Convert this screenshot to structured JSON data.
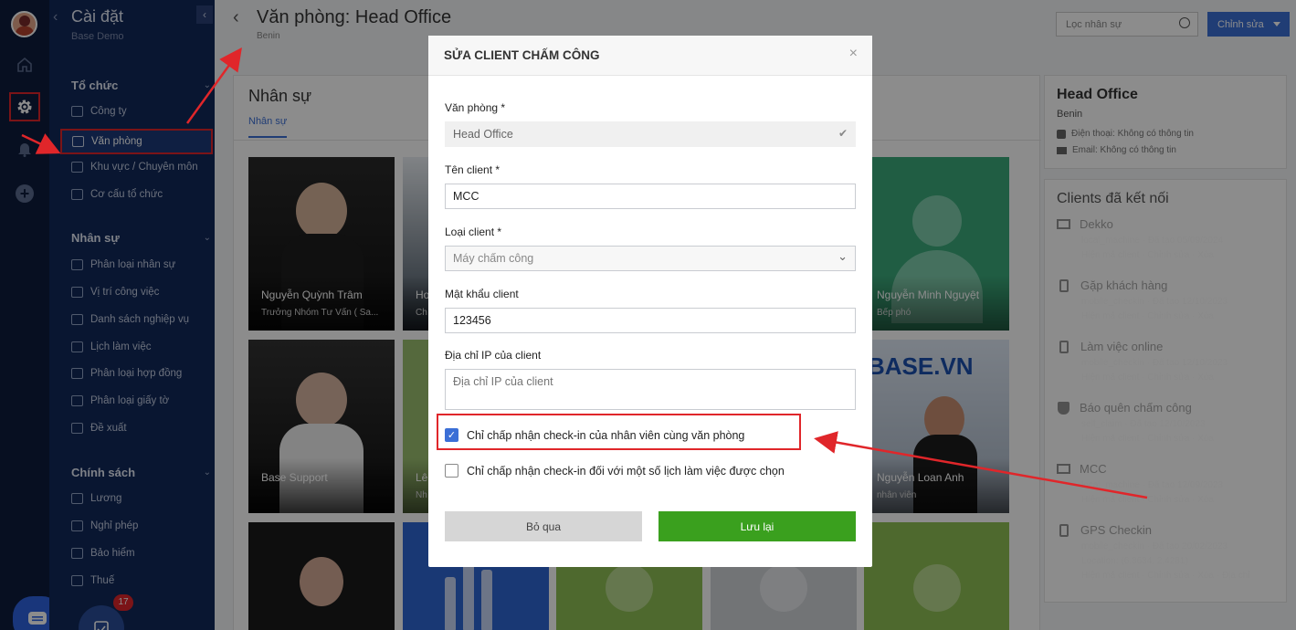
{
  "rail": {
    "badge_count": "17"
  },
  "sidebar": {
    "title": "Cài đặt",
    "subtitle": "Base Demo",
    "sections": [
      {
        "label": "Tổ chức",
        "items": [
          "Công ty",
          "Văn phòng",
          "Khu vực / Chuyên môn",
          "Cơ cấu tổ chức"
        ]
      },
      {
        "label": "Nhân sự",
        "items": [
          "Phân loại nhân sự",
          "Vị trí công việc",
          "Danh sách nghiệp vụ",
          "Lịch làm việc",
          "Phân loại hợp đồng",
          "Phân loại giấy tờ",
          "Đề xuất"
        ]
      },
      {
        "label": "Chính sách",
        "items": [
          "Lương",
          "Nghỉ phép",
          "Bảo hiểm",
          "Thuế"
        ]
      }
    ]
  },
  "header": {
    "title": "Văn phòng: Head Office",
    "subtitle": "Benin",
    "search_placeholder": "Lọc nhân sự",
    "edit_label": "Chỉnh sửa"
  },
  "panel": {
    "title": "Nhân sự",
    "tab": "Nhân sự"
  },
  "people": [
    {
      "name": "Nguyễn Quỳnh Trâm",
      "role": "Trưởng Nhóm Tư Vấn ( Sa..."
    },
    {
      "name": "Ho",
      "role": "Ch"
    },
    {
      "name": "Nguyễn Minh Nguyệt",
      "role": "Bếp phó"
    },
    {
      "name": "Base Support",
      "role": ""
    },
    {
      "name": "Lê",
      "role": "Nh"
    },
    {
      "name": "Nguyễn Loan Anh",
      "role": "nhân viên"
    }
  ],
  "brand_text": "BASE.VN",
  "office": {
    "name": "Head Office",
    "location": "Benin",
    "phone": "Điện thoại: Không có thông tin",
    "email": "Email: Không có thông tin"
  },
  "clients": {
    "title": "Clients đã kết nối",
    "items": [
      {
        "name": "Dekko",
        "meta": "local_machine · Đã tạo 05/09/2024",
        "actions": "Hiện mã client · Chỉnh sửa · Xóa",
        "icon": "desktop-icon"
      },
      {
        "name": "Gặp khách hàng",
        "meta": "mobile_checkin · Đã tạo 12/10/2023",
        "actions": "Hiện mã client · Chỉnh sửa · Xóa",
        "icon": "mobile-icon"
      },
      {
        "name": "Làm việc online",
        "meta": "mobile_checkin · Đã tạo 12/10/2023",
        "actions": "Hiện mã client · Chỉnh sửa · Xóa",
        "icon": "mobile-icon"
      },
      {
        "name": "Báo quên chấm công",
        "meta": "self_claim · Đã tạo 12/10/2023",
        "actions": "Hiện mã client · Chỉnh sửa · Xóa",
        "icon": "shield-check-icon"
      },
      {
        "name": "MCC",
        "meta": "local_machine · Đã tạo 12/09/2023",
        "actions": "Hiện mã client · Chỉnh sửa · Xóa",
        "icon": "desktop-icon"
      },
      {
        "name": "GPS Checkin",
        "meta": "mobile_checkin · Đã tạo 20/02/2023",
        "location": "Location: (6.3634, 2.4281)",
        "actions": "Hiện mã client · Chỉnh sửa · Xóa · Địa chỉ",
        "icon": "mobile-icon"
      }
    ]
  },
  "modal": {
    "title": "SỬA CLIENT CHẤM CÔNG",
    "office_label": "Văn phòng *",
    "office_value": "Head Office",
    "name_label": "Tên client *",
    "name_value": "MCC",
    "type_label": "Loại client *",
    "type_value": "Máy chấm công",
    "password_label": "Mật khẩu client",
    "password_value": "123456",
    "ip_label": "Địa chỉ IP của client",
    "ip_placeholder": "Địa chỉ IP của client",
    "check1_label": "Chỉ chấp nhận check-in của nhân viên cùng văn phòng",
    "check1_checked": true,
    "check2_label": "Chỉ chấp nhận check-in đối với một số lịch làm việc được chọn",
    "check2_checked": false,
    "cancel_label": "Bỏ qua",
    "save_label": "Lưu lại"
  },
  "colors": {
    "sidebar": "#12295a",
    "rail": "#0e1d3d",
    "primary": "#3b6fd6",
    "save": "#3aa01e",
    "annotation": "#e0262a"
  }
}
